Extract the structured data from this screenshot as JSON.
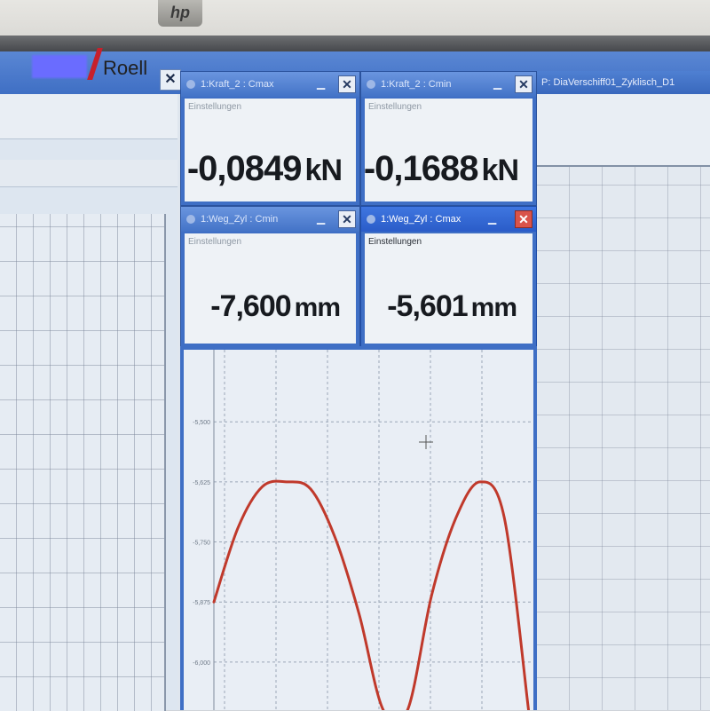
{
  "bezel": {
    "logo": "hp"
  },
  "brand": {
    "name": "Roell"
  },
  "background": {
    "right_title": "P: DiaVerschiff01_Zyklisch_D1"
  },
  "windows": [
    {
      "id": "force-1",
      "title": "1:Kraft_2 : Cmax",
      "settings": "Einstellungen",
      "value": "-0,0849",
      "unit": "kN"
    },
    {
      "id": "force-2",
      "title": "1:Kraft_2 : Cmin",
      "settings": "Einstellungen",
      "value": "-0,1688",
      "unit": "kN"
    },
    {
      "id": "travel-1",
      "title": "1:Weg_Zyl : Cmin",
      "settings": "Einstellungen",
      "value": "-7,600",
      "unit": "mm"
    },
    {
      "id": "travel-2",
      "title": "1:Weg_Zyl : Cmax",
      "settings": "Einstellungen",
      "value": "-5,601",
      "unit": "mm"
    }
  ],
  "chart_data": {
    "type": "line",
    "title": "",
    "xlabel": "",
    "ylabel": "",
    "y_ticks": [
      "-5,500",
      "-5,625",
      "-5,750",
      "-5,875",
      "-6,000"
    ],
    "series": [
      {
        "color": "#c0392b",
        "x": [
          0,
          0.5,
          1.0,
          1.5,
          2.0,
          2.5,
          3.0,
          3.5,
          4.0,
          4.5,
          5.0,
          5.5,
          6.0,
          6.5
        ],
        "y": [
          -5.875,
          -5.72,
          -5.635,
          -5.625,
          -5.64,
          -5.74,
          -5.9,
          -6.1,
          -6.1,
          -5.86,
          -5.7,
          -5.625,
          -5.7,
          -6.1
        ]
      }
    ],
    "grid": true
  }
}
